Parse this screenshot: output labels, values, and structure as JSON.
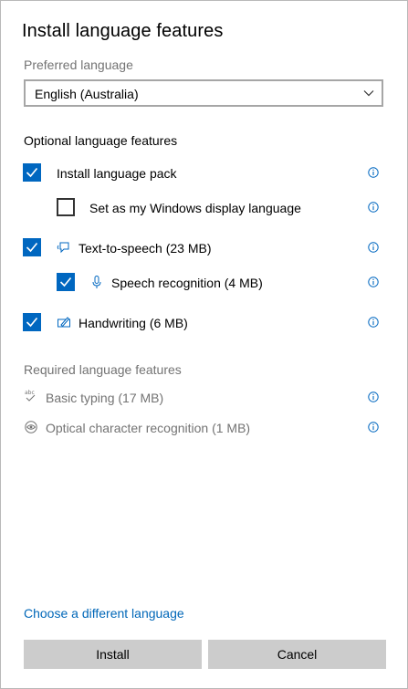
{
  "dialog": {
    "title": "Install language features"
  },
  "preferred_language": {
    "label": "Preferred language",
    "selected": "English (Australia)"
  },
  "optional_features": {
    "heading": "Optional language features",
    "items": [
      {
        "label": "Install language pack",
        "checked": true,
        "icon": null
      },
      {
        "label": "Set as my Windows display language",
        "checked": false,
        "icon": null
      },
      {
        "label": "Text-to-speech (23 MB)",
        "checked": true,
        "icon": "speech-bubble-icon"
      },
      {
        "label": "Speech recognition (4 MB)",
        "checked": true,
        "icon": "microphone-icon"
      },
      {
        "label": "Handwriting (6 MB)",
        "checked": true,
        "icon": "pen-icon"
      }
    ]
  },
  "required_features": {
    "heading": "Required language features",
    "items": [
      {
        "label": "Basic typing (17 MB)",
        "icon": "abc-check-icon"
      },
      {
        "label": "Optical character recognition (1 MB)",
        "icon": "ocr-eye-icon"
      }
    ]
  },
  "footer": {
    "link": "Choose a different language",
    "install_label": "Install",
    "cancel_label": "Cancel"
  },
  "colors": {
    "accent": "#0067c0",
    "link": "#0067b8",
    "muted_text": "#737373",
    "button_bg": "#cccccc"
  }
}
